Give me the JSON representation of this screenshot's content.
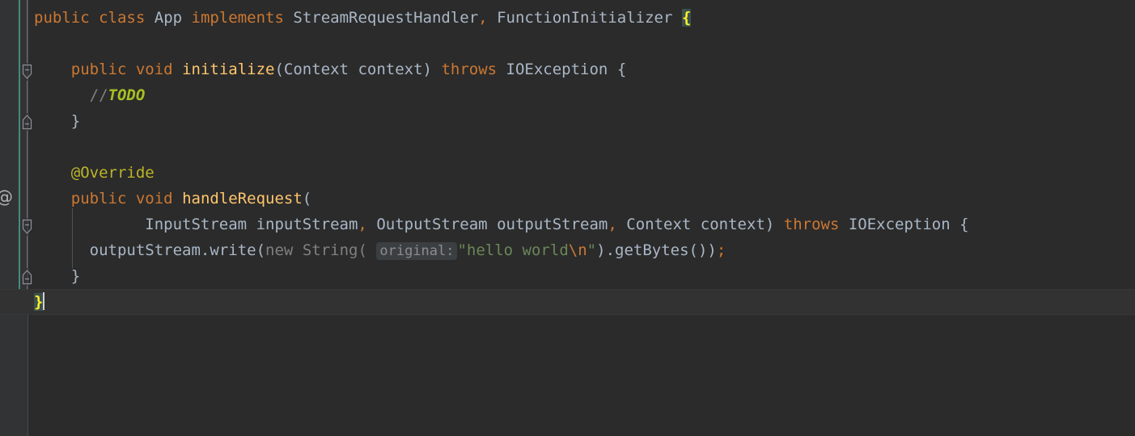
{
  "editor": {
    "language": "Java",
    "theme": "Darcula",
    "background_color": "#2b2b2b",
    "gutter_color": "#313335",
    "caret_line_color": "#323232",
    "vcs_marker_color": "#4a8a78",
    "gutter_annotation_icon": "@",
    "caret_position_line": 12
  },
  "colors": {
    "keyword": "#cc7832",
    "identifier": "#a9b7c6",
    "method": "#ffc66d",
    "annotation": "#bbb529",
    "string": "#6a8759",
    "comment": "#808080",
    "todo": "#a8c023",
    "escape": "#cc7832",
    "brace_match_bg": "#3b514d",
    "brace_match_fg": "#ffef28",
    "param_hint_bg": "#3c3f41",
    "param_hint_fg": "#8c8c8c"
  },
  "code": {
    "line1": {
      "kw_public": "public",
      "kw_class": "class",
      "name_app": "App",
      "kw_implements": "implements",
      "type_handler": "StreamRequestHandler",
      "comma": ",",
      "type_initializer": "FunctionInitializer",
      "brace_open": "{"
    },
    "line3": {
      "kw_public": "public",
      "kw_void": "void",
      "method_name": "initialize",
      "paren_open": "(",
      "type_context": "Context",
      "param_context": "context",
      "paren_close": ")",
      "kw_throws": "throws",
      "type_ioexception": "IOException",
      "brace_open": "{"
    },
    "line4": {
      "comment_slashes": "//",
      "todo": "TODO"
    },
    "line5": {
      "brace_close": "}"
    },
    "line7": {
      "annotation": "@Override"
    },
    "line8": {
      "kw_public": "public",
      "kw_void": "void",
      "method_name": "handleRequest",
      "paren_open": "("
    },
    "line9": {
      "type_inputstream": "InputStream",
      "param_inputstream": "inputStream",
      "comma1": ",",
      "type_outputstream": "OutputStream",
      "param_outputstream": "outputStream",
      "comma2": ",",
      "type_context": "Context",
      "param_context": "context",
      "paren_close": ")",
      "kw_throws": "throws",
      "type_ioexception": "IOException",
      "brace_open": "{"
    },
    "line10": {
      "receiver": "outputStream",
      "dot": ".",
      "call_write": "write",
      "paren_open": "(",
      "kw_new": "new",
      "type_string": "String",
      "string_paren_open": "(",
      "param_hint": "original:",
      "string_literal_start": "\"hello world",
      "escape_n": "\\n",
      "string_literal_end": "\"",
      "paren_close_string": ")",
      "dot2": ".",
      "call_getbytes": "getBytes",
      "parens_getbytes": "()",
      "paren_close_write": ")",
      "semicolon": ";"
    },
    "line11": {
      "brace_close": "}"
    },
    "line12": {
      "brace_close": "}"
    }
  }
}
